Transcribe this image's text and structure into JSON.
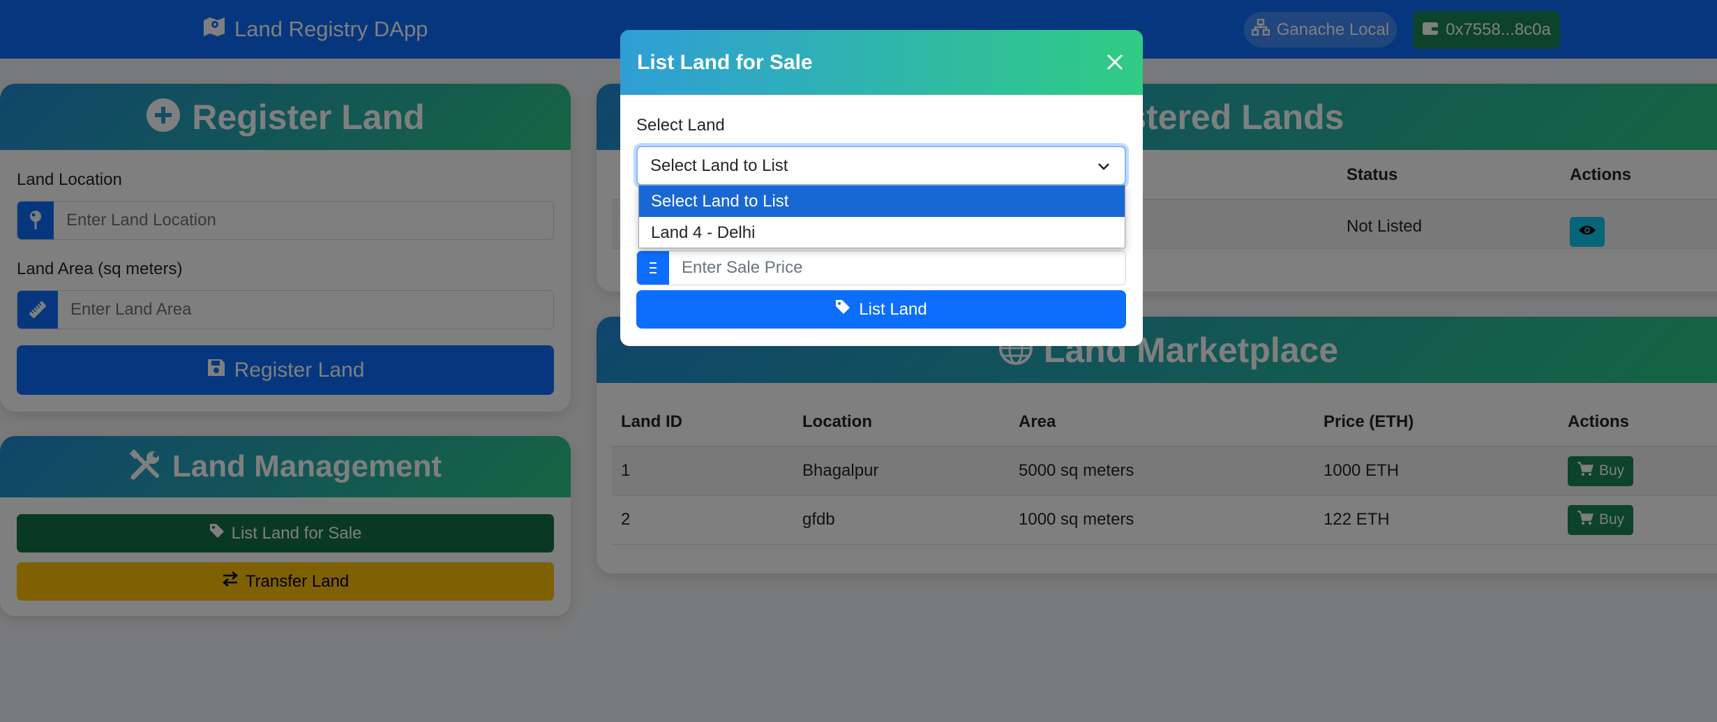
{
  "navbar": {
    "brand": "Land Registry DApp",
    "network": "Ganache Local",
    "account": "0x7558...8c0a"
  },
  "register": {
    "title": "Register Land",
    "location_label": "Land Location",
    "location_placeholder": "Enter Land Location",
    "area_label": "Land Area (sq meters)",
    "area_placeholder": "Enter Land Area",
    "button": "Register Land"
  },
  "management": {
    "title": "Land Management",
    "list_button": "List Land for Sale",
    "transfer_button": "Transfer Land"
  },
  "my_lands": {
    "title": "My Registered Lands",
    "columns": [
      "Status",
      "Actions"
    ],
    "rows": [
      {
        "status": "Not Listed"
      }
    ]
  },
  "marketplace": {
    "title": "Land Marketplace",
    "columns": [
      "Land ID",
      "Location",
      "Area",
      "Price (ETH)",
      "Actions"
    ],
    "rows": [
      {
        "id": "1",
        "location": "Bhagalpur",
        "area": "5000 sq meters",
        "price": "1000 ETH",
        "action": "Buy"
      },
      {
        "id": "2",
        "location": "gfdb",
        "area": "1000 sq meters",
        "price": "122 ETH",
        "action": "Buy"
      }
    ]
  },
  "modal": {
    "title": "List Land for Sale",
    "select_label": "Select Land",
    "select_value": "Select Land to List",
    "options": [
      "Select Land to List",
      "Land 4 - Delhi"
    ],
    "price_placeholder": "Enter Sale Price",
    "button": "List Land"
  },
  "colors": {
    "primary": "#0d6efd",
    "success": "#198754",
    "warning": "#ffc107",
    "info": "#0dcaf0",
    "gradient_start": "#1f8cd6",
    "gradient_end": "#2ec985"
  }
}
